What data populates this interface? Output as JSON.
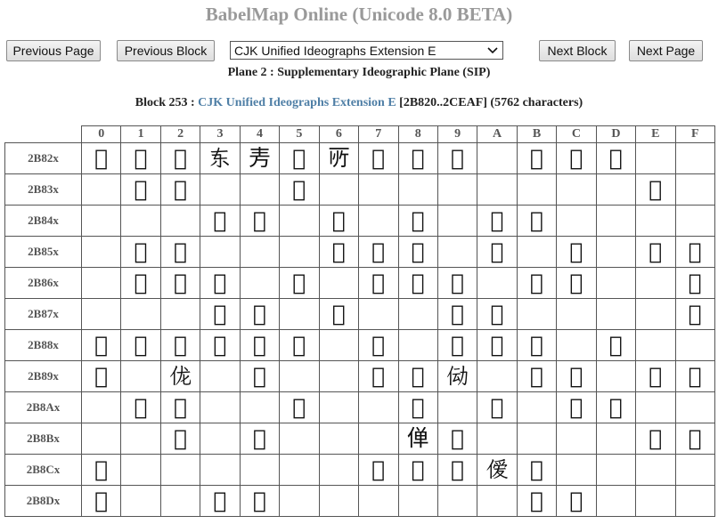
{
  "page": {
    "title": "BabelMap Online (Unicode 8.0 BETA)"
  },
  "nav": {
    "prev_page": "Previous Page",
    "prev_block": "Previous Block",
    "block_select": "CJK Unified Ideographs Extension E",
    "next_block": "Next Block",
    "next_page": "Next Page"
  },
  "plane_label": "Plane 2 : Supplementary Ideographic Plane (SIP)",
  "block_info": {
    "prefix": "Block 253 : ",
    "name": "CJK Unified Ideographs Extension E",
    "range": " [2B820..2CEAF] (5762 characters)"
  },
  "table": {
    "columns": [
      "0",
      "1",
      "2",
      "3",
      "4",
      "5",
      "6",
      "7",
      "8",
      "9",
      "A",
      "B",
      "C",
      "D",
      "E",
      "F"
    ],
    "rows": [
      {
        "label": "2B82x",
        "cells": [
          "𫠠",
          "𫠡",
          "𫠢",
          "𫠣",
          "𫠤",
          "𫠥",
          "𫠦",
          "𫠧",
          "𫠨",
          "𫠩",
          "",
          "𫠫",
          "𫠬",
          "𫠭",
          "",
          ""
        ]
      },
      {
        "label": "2B83x",
        "cells": [
          "",
          "𫠱",
          "𫠲",
          "",
          "",
          "𫠵",
          "",
          "",
          "",
          "",
          "",
          "",
          "",
          "",
          "𫠾",
          ""
        ]
      },
      {
        "label": "2B84x",
        "cells": [
          "",
          "",
          "",
          "𫡃",
          "𫡄",
          "",
          "𫡆",
          "",
          "𫡈",
          "",
          "𫡊",
          "𫡋",
          "",
          "",
          "",
          ""
        ]
      },
      {
        "label": "2B85x",
        "cells": [
          "",
          "𫡑",
          "𫡒",
          "",
          "",
          "",
          "𫡖",
          "𫡗",
          "𫡘",
          "",
          "𫡚",
          "",
          "𫡜",
          "",
          "𫡞",
          "𫡟"
        ]
      },
      {
        "label": "2B86x",
        "cells": [
          "",
          "𫡡",
          "𫡢",
          "𫡣",
          "",
          "𫡥",
          "",
          "𫡧",
          "𫡨",
          "𫡩",
          "",
          "𫡫",
          "𫡬",
          "",
          "",
          "𫡯"
        ]
      },
      {
        "label": "2B87x",
        "cells": [
          "",
          "",
          "",
          "𫡳",
          "𫡴",
          "",
          "𫡶",
          "",
          "",
          "𫡹",
          "𫡺",
          "",
          "",
          "",
          "",
          "𫡿"
        ]
      },
      {
        "label": "2B88x",
        "cells": [
          "𫢀",
          "𫢁",
          "𫢂",
          "𫢃",
          "𫢄",
          "𫢅",
          "",
          "𫢇",
          "",
          "𫢉",
          "𫢊",
          "𫢋",
          "",
          "𫢍",
          "",
          ""
        ]
      },
      {
        "label": "2B89x",
        "cells": [
          "𫢐",
          "",
          "𫢒",
          "",
          "𫢔",
          "",
          "",
          "𫢗",
          "𫢘",
          "𫢙",
          "",
          "𫢛",
          "𫢜",
          "",
          "𫢞",
          "𫢟"
        ]
      },
      {
        "label": "2B8Ax",
        "cells": [
          "",
          "𫢡",
          "𫢢",
          "",
          "",
          "𫢥",
          "",
          "",
          "𫢨",
          "",
          "𫢪",
          "",
          "𫢬",
          "𫢭",
          "",
          ""
        ]
      },
      {
        "label": "2B8Bx",
        "cells": [
          "",
          "",
          "𫢲",
          "",
          "𫢴",
          "",
          "",
          "",
          "𫢸",
          "𫢹",
          "",
          "",
          "",
          "",
          "𫢾",
          "𫢿"
        ]
      },
      {
        "label": "2B8Cx",
        "cells": [
          "𫣀",
          "",
          "",
          "",
          "",
          "",
          "",
          "𫣇",
          "𫣈",
          "𫣉",
          "𫣊",
          "𫣋",
          "",
          "",
          "",
          ""
        ]
      },
      {
        "label": "2B8Dx",
        "cells": [
          "𫣐",
          "",
          "",
          "𫣓",
          "𫣔",
          "",
          "",
          "",
          "",
          "",
          "",
          "𫣛",
          "𫣜",
          "",
          "",
          ""
        ]
      }
    ]
  }
}
